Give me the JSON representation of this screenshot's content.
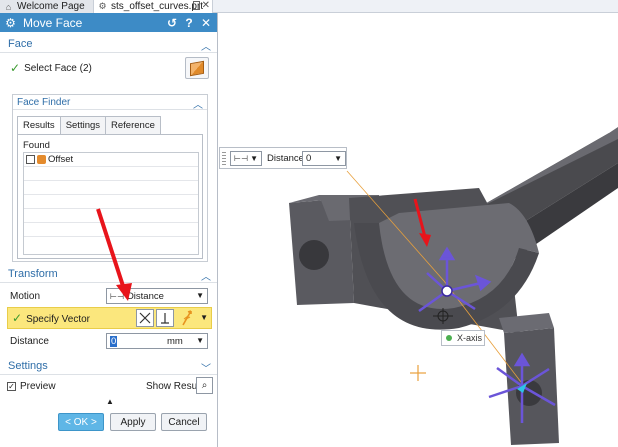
{
  "tabs": [
    {
      "label": "Welcome Page",
      "icon": "home-icon"
    },
    {
      "label": "sts_offset_curves.prt",
      "icon": "part-file-icon"
    }
  ],
  "dialog": {
    "title": "Move Face",
    "face_section": {
      "title": "Face",
      "select_label": "Select Face (2)"
    },
    "face_finder": {
      "title": "Face Finder",
      "tabs": [
        "Results",
        "Settings",
        "Reference"
      ],
      "found_label": "Found",
      "items": [
        "Offset"
      ]
    },
    "transform": {
      "title": "Transform",
      "motion_label": "Motion",
      "motion_value": "Distance",
      "vector_label": "Specify Vector",
      "distance_label": "Distance",
      "distance_value": "0",
      "distance_unit": "mm"
    },
    "settings_title": "Settings",
    "preview_label": "Preview",
    "show_result_label": "Show Result",
    "ok_label": "< OK >",
    "apply_label": "Apply",
    "cancel_label": "Cancel"
  },
  "viewport": {
    "distance_label": "Distance",
    "distance_value": "0",
    "axis_label": "X-axis"
  },
  "colors": {
    "titlebar": "#3d8bc6",
    "highlight": "#fbe77d",
    "arrow": "#e8141b",
    "handle": "#6b55d8",
    "part": "#5a5a5e"
  }
}
